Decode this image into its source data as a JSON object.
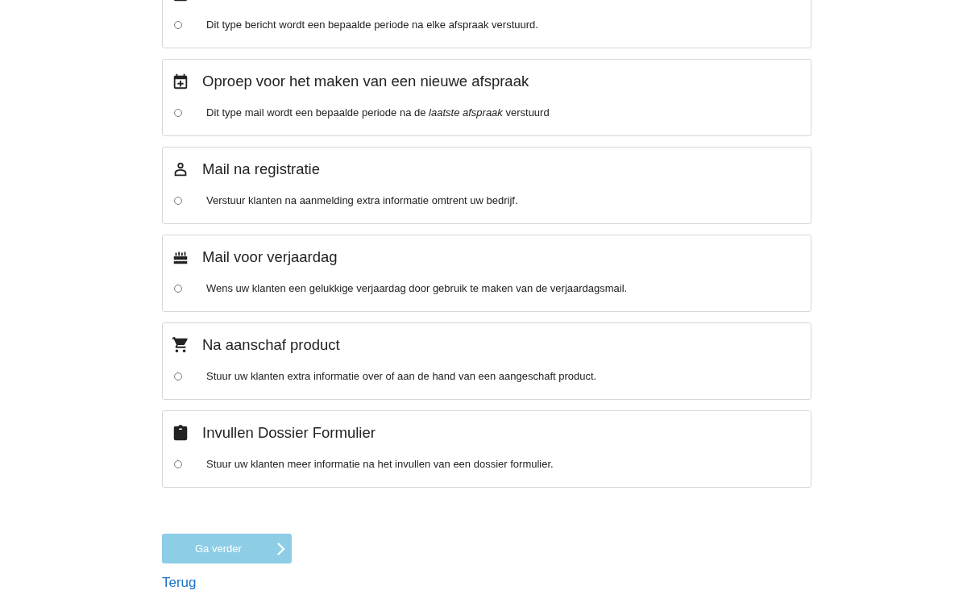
{
  "options": [
    {
      "description": "Dit type bericht wordt een bepaalde periode na elke afspraak verstuurd.",
      "selected": false
    },
    {
      "title": "Oproep voor het maken van een nieuwe afspraak",
      "description": "Dit type mail wordt een bepaalde periode na de *laatste afspraak* verstuurd",
      "selected": false
    },
    {
      "title": "Mail na registratie",
      "description": "Verstuur klanten na aanmelding extra informatie omtrent uw bedrijf.",
      "selected": false
    },
    {
      "title": "Mail voor verjaardag",
      "description": "Wens uw klanten een gelukkige verjaardag door gebruik te maken van de verjaardagsmail.",
      "selected": false
    },
    {
      "title": "Na aanschaf product",
      "description": "Stuur uw klanten extra informatie over of aan de hand van een aangeschaft product.",
      "selected": false
    },
    {
      "title": "Invullen Dossier Formulier",
      "description": "Stuur uw klanten meer informatie na het invullen van een dossier formulier.",
      "selected": false
    }
  ],
  "continue_button": {
    "label": "Ga verder",
    "disabled": true
  },
  "back_link": "Terug"
}
